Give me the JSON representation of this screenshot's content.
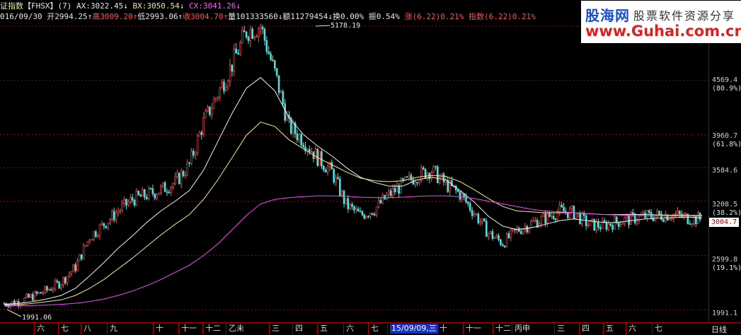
{
  "header": {
    "index_name": "证指数",
    "code": "【FHSX】",
    "mode": "(7)",
    "ax": "AX:3022.45↓",
    "bx": "BX:3050.54↓",
    "cx": "CX:3041.26↓",
    "date": "016/09/30",
    "open": "开2994.25↑",
    "high": "高3009.20↑",
    "low": "低2993.06↑",
    "close": "收3004.70↑",
    "volume": "量101333560↓",
    "amount": "额11279454↓",
    "turnover": "换0.00%",
    "amplitude": "振0.54%",
    "change": "涨(6.22)0.21%",
    "index_change": "指数(6.22)0.21%"
  },
  "logo": {
    "brand": "股海网",
    "tagline": "股票软件资源分享",
    "url": "www.Guhai.com.cn"
  },
  "annotations": {
    "peak": "5178.19",
    "trough": "1991.06"
  },
  "y_axis": {
    "ticks": [
      {
        "value": "4569.4",
        "pct": "(80.9%)"
      },
      {
        "value": "3960.7",
        "pct": "(61.8%)"
      },
      {
        "value": "3584.6",
        "pct": ""
      },
      {
        "value": "3208.5",
        "pct": "(38.2%)"
      },
      {
        "value": "2599.8",
        "pct": "(19.1%)"
      },
      {
        "value": "1991.1",
        "pct": ""
      }
    ],
    "current": "3004.7"
  },
  "x_axis": {
    "labels": [
      "六",
      "七",
      "八",
      "九",
      "十",
      "十一",
      "十二",
      "乙未",
      "三",
      "四",
      "五",
      "六",
      "七",
      "15/09/09,三",
      "十",
      "十一",
      "十二",
      "丙申",
      "三",
      "四",
      "五",
      "六",
      "七"
    ],
    "selected": "15/09/09,三",
    "right_tab": "日线"
  },
  "colors": {
    "up": "#ff5050",
    "down": "#50e0e0",
    "ma_white": "#f0f0f0",
    "ma_yellow": "#f0f080",
    "ma_magenta": "#ff40ff",
    "grid": "#a00000"
  },
  "chart_data": {
    "type": "line",
    "series": [
      {
        "name": "close",
        "values": [
          2060,
          2080,
          2140,
          2210,
          2300,
          2470,
          2810,
          2950,
          3100,
          3230,
          3280,
          3340,
          3420,
          3620,
          4100,
          4420,
          4750,
          5120,
          5178,
          4650,
          4050,
          3900,
          3700,
          3540,
          3170,
          3050,
          3120,
          3280,
          3400,
          3500,
          3560,
          3400,
          3290,
          3080,
          2850,
          2740,
          2880,
          2960,
          3020,
          3100,
          3080,
          2950,
          2930,
          2980,
          3010,
          3040,
          3050,
          3060,
          3020,
          3004.7
        ]
      },
      {
        "name": "AX",
        "values": [
          2050,
          2060,
          2080,
          2110,
          2150,
          2230,
          2370,
          2520,
          2680,
          2820,
          2970,
          3100,
          3210,
          3330,
          3560,
          3880,
          4200,
          4480,
          4600,
          4450,
          4150,
          3960,
          3830,
          3720,
          3590,
          3480,
          3420,
          3380,
          3380,
          3450,
          3480,
          3450,
          3330,
          3200,
          3040,
          2930,
          2890,
          2910,
          2950,
          2990,
          3010,
          2990,
          2970,
          2970,
          2990,
          3010,
          3020,
          3025,
          3030,
          3022.45
        ]
      },
      {
        "name": "BX",
        "values": [
          2040,
          2045,
          2060,
          2080,
          2100,
          2150,
          2230,
          2330,
          2450,
          2570,
          2700,
          2830,
          2950,
          3060,
          3230,
          3450,
          3700,
          3950,
          4100,
          4050,
          3900,
          3800,
          3700,
          3620,
          3540,
          3470,
          3440,
          3430,
          3440,
          3480,
          3500,
          3490,
          3430,
          3340,
          3240,
          3150,
          3100,
          3090,
          3080,
          3080,
          3080,
          3070,
          3060,
          3060,
          3060,
          3060,
          3055,
          3052,
          3051,
          3050.54
        ]
      },
      {
        "name": "CX",
        "values": [
          2030,
          2032,
          2036,
          2042,
          2050,
          2062,
          2082,
          2110,
          2150,
          2200,
          2260,
          2330,
          2410,
          2490,
          2600,
          2730,
          2890,
          3050,
          3180,
          3230,
          3250,
          3260,
          3270,
          3270,
          3265,
          3255,
          3250,
          3250,
          3255,
          3265,
          3270,
          3270,
          3260,
          3240,
          3210,
          3180,
          3150,
          3120,
          3100,
          3090,
          3080,
          3070,
          3060,
          3055,
          3050,
          3045,
          3043,
          3042,
          3041,
          3041.26
        ]
      }
    ],
    "ylim": [
      1991.06,
      5178.19
    ]
  }
}
